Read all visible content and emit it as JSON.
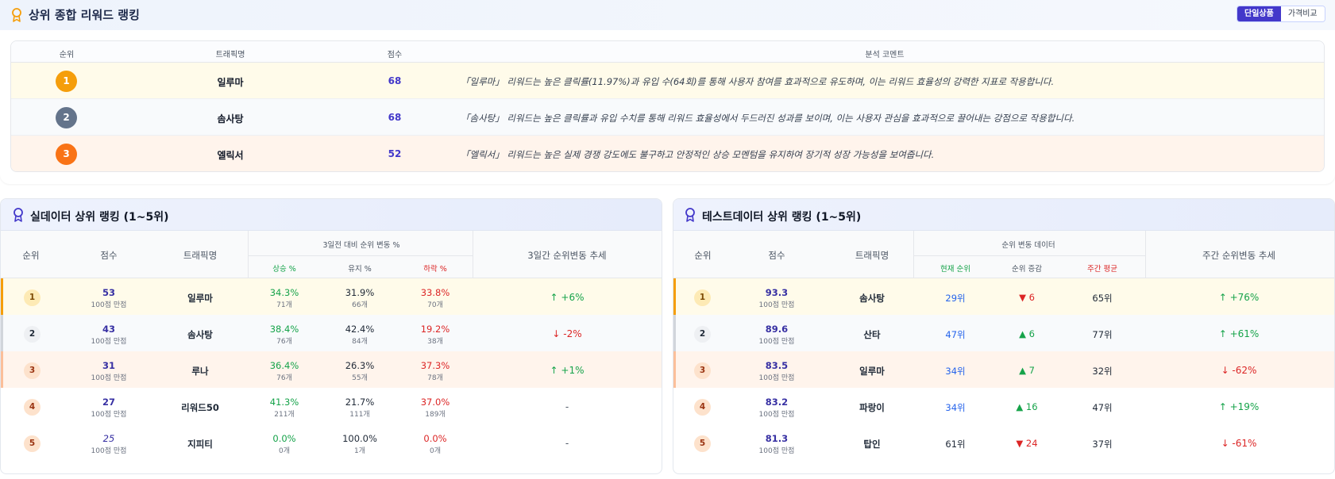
{
  "top_section": {
    "title": "상위 종합 리워드 랭킹",
    "toggle": {
      "active": "단일상품",
      "inactive": "가격비교"
    },
    "headers": {
      "rank": "순위",
      "name": "트래픽명",
      "score": "점수",
      "comment": "분석 코멘트"
    },
    "rows": [
      {
        "rank": "1",
        "name": "일루마",
        "score": "68",
        "comment": "「일루마」 리워드는 높은 클릭률(11.97%)과 유입 수(64회)를 통해 사용자 참여를 효과적으로 유도하며, 이는 리워드 효율성의 강력한 지표로 작용합니다."
      },
      {
        "rank": "2",
        "name": "솜사탕",
        "score": "68",
        "comment": "「솜사탕」 리워드는 높은 클릭률과 유입 수치를 통해 리워드 효율성에서 두드러진 성과를 보이며, 이는 사용자 관심을 효과적으로 끌어내는 강점으로 작용합니다."
      },
      {
        "rank": "3",
        "name": "엘릭서",
        "score": "52",
        "comment": "「엘릭서」 리워드는 높은 실제 경쟁 강도에도 불구하고 안정적인 상승 모멘텀을 유지하여 장기적 성장 가능성을 보여줍니다."
      }
    ]
  },
  "real_panel": {
    "title": "실데이터 상위 랭킹 (1~5위)",
    "headers": {
      "rank": "순위",
      "score": "점수",
      "name": "트래픽명",
      "group": "3일전 대비 순위 변동 %",
      "up": "상승 %",
      "keep": "유지 %",
      "down": "하락 %",
      "trend": "3일간 순위변동 추세"
    },
    "rows": [
      {
        "rank": "1",
        "score": "53",
        "score_sub": "100점 만점",
        "name": "일루마",
        "up": "34.3%",
        "up_sub": "71개",
        "keep": "31.9%",
        "keep_sub": "66개",
        "down": "33.8%",
        "down_sub": "70개",
        "trend": "↑  +6%"
      },
      {
        "rank": "2",
        "score": "43",
        "score_sub": "100점 만점",
        "name": "솜사탕",
        "up": "38.4%",
        "up_sub": "76개",
        "keep": "42.4%",
        "keep_sub": "84개",
        "down": "19.2%",
        "down_sub": "38개",
        "trend": "↓  -2%"
      },
      {
        "rank": "3",
        "score": "31",
        "score_sub": "100점 만점",
        "name": "루나",
        "up": "36.4%",
        "up_sub": "76개",
        "keep": "26.3%",
        "keep_sub": "55개",
        "down": "37.3%",
        "down_sub": "78개",
        "trend": "↑  +1%"
      },
      {
        "rank": "4",
        "score": "27",
        "score_sub": "100점 만점",
        "name": "리워드50",
        "up": "41.3%",
        "up_sub": "211개",
        "keep": "21.7%",
        "keep_sub": "111개",
        "down": "37.0%",
        "down_sub": "189개",
        "trend": "-"
      },
      {
        "rank": "5",
        "score": "25",
        "score_sub": "100점 만점",
        "name": "지피티",
        "up": "0.0%",
        "up_sub": "0개",
        "keep": "100.0%",
        "keep_sub": "1개",
        "down": "0.0%",
        "down_sub": "0개",
        "trend": "-"
      }
    ]
  },
  "test_panel": {
    "title": "테스트데이터 상위 랭킹 (1~5위)",
    "headers": {
      "rank": "순위",
      "score": "점수",
      "name": "트래픽명",
      "group": "순위 변동 데이터",
      "current": "현재 순위",
      "delta": "순위 증감",
      "weekly": "주간 평균",
      "trend": "주간 순위변동 추세"
    },
    "rows": [
      {
        "rank": "1",
        "score": "93.3",
        "score_sub": "100점 만점",
        "name": "솜사탕",
        "current": "29위",
        "delta": "▼ 6",
        "weekly": "65위",
        "trend": "↑  +76%"
      },
      {
        "rank": "2",
        "score": "89.6",
        "score_sub": "100점 만점",
        "name": "산타",
        "current": "47위",
        "delta": "▲ 6",
        "weekly": "77위",
        "trend": "↑  +61%"
      },
      {
        "rank": "3",
        "score": "83.5",
        "score_sub": "100점 만점",
        "name": "일루마",
        "current": "34위",
        "delta": "▲ 7",
        "weekly": "32위",
        "trend": "↓  -62%"
      },
      {
        "rank": "4",
        "score": "83.2",
        "score_sub": "100점 만점",
        "name": "파랑이",
        "current": "34위",
        "delta": "▲ 16",
        "weekly": "47위",
        "trend": "↑  +19%"
      },
      {
        "rank": "5",
        "score": "81.3",
        "score_sub": "100점 만점",
        "name": "탑인",
        "current": "61위",
        "delta": "▼ 24",
        "weekly": "37위",
        "trend": "↓  -61%"
      }
    ]
  },
  "colors": {
    "accent": "#4338ca",
    "gold": "#f59e0b",
    "up": "#16a34a",
    "down": "#dc2626",
    "blue": "#2563eb"
  }
}
